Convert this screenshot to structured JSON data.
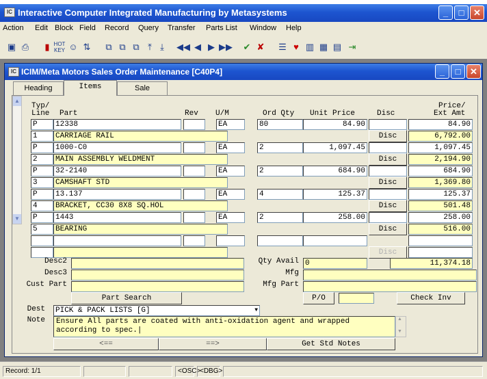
{
  "app": {
    "title": "Interactive Computer Integrated Manufacturing by Metasystems",
    "icon": "app-icon"
  },
  "menu": [
    "Action",
    "Edit",
    "Block",
    "Field",
    "Record",
    "Query",
    "Transfer",
    "Parts List",
    "Window",
    "Help"
  ],
  "toolbar_icons": [
    "save-icon",
    "print-icon",
    "stop-icon",
    "hotkey-icon",
    "user-check-icon",
    "sort-icon",
    "copy-record-icon",
    "paste-record-icon",
    "duplicate-record-icon",
    "insert-record-icon",
    "delete-record-icon",
    "first-record-icon",
    "previous-record-icon",
    "next-record-icon",
    "last-record-icon",
    "check-icon",
    "cancel-icon",
    "list-icon",
    "favorite-icon",
    "chart-icon",
    "table-icon",
    "grid-icon",
    "exit-icon"
  ],
  "child": {
    "title": "ICIM/Meta Motors   Sales Order Maintenance [C40P4]"
  },
  "tabs": [
    {
      "label": "Heading",
      "active": false
    },
    {
      "label": "Items",
      "active": true
    },
    {
      "label": "Sale",
      "active": false
    }
  ],
  "columns": {
    "typ": "Typ/",
    "line": "Line",
    "part": "Part",
    "rev": "Rev",
    "um": "U/M",
    "ord_qty": "Ord Qty",
    "unit_price": "Unit Price",
    "disc": "Disc",
    "price": "Price/",
    "ext_amt": "Ext Amt"
  },
  "items": [
    {
      "typ": "P",
      "part": "12338",
      "rev": "",
      "um": "EA",
      "ord_qty": "80",
      "unit_price": "84.90",
      "price": "84.90",
      "line": "1",
      "desc": "CARRIAGE RAIL",
      "disc_label": "Disc",
      "ext_amt": "6,792.00"
    },
    {
      "typ": "P",
      "part": "1000-C0",
      "rev": "",
      "um": "EA",
      "ord_qty": "2",
      "unit_price": "1,097.45",
      "price": "1,097.45",
      "line": "2",
      "desc": "MAIN ASSEMBLY WELDMENT",
      "disc_label": "Disc",
      "ext_amt": "2,194.90"
    },
    {
      "typ": "P",
      "part": "32-2140",
      "rev": "",
      "um": "EA",
      "ord_qty": "2",
      "unit_price": "684.90",
      "price": "684.90",
      "line": "3",
      "desc": "CAMSHAFT STD",
      "disc_label": "Disc",
      "ext_amt": "1,369.80"
    },
    {
      "typ": "P",
      "part": "13.137",
      "rev": "",
      "um": "EA",
      "ord_qty": "4",
      "unit_price": "125.37",
      "price": "125.37",
      "line": "4",
      "desc": "BRACKET, CC30 8X8 SQ.HOL",
      "disc_label": "Disc",
      "ext_amt": "501.48"
    },
    {
      "typ": "P",
      "part": "1443",
      "rev": "",
      "um": "EA",
      "ord_qty": "2",
      "unit_price": "258.00",
      "price": "258.00",
      "line": "5",
      "desc": "BEARING",
      "disc_label": "Disc",
      "ext_amt": "516.00"
    }
  ],
  "empty_row": {
    "disc_label": "Disc"
  },
  "detail": {
    "desc2_label": "Desc2",
    "desc2_value": "",
    "desc3_label": "Desc3",
    "desc3_value": "",
    "cust_part_label": "Cust Part",
    "cust_part_value": "",
    "qty_avail_label": "Qty Avail",
    "qty_avail_value": "0",
    "mfg_label": "Mfg",
    "mfg_value": "",
    "mfg_part_label": "Mfg Part",
    "mfg_part_value": "",
    "total": "11,374.18"
  },
  "buttons": {
    "part_search": "Part Search",
    "po": "P/O",
    "check_inv": "Check Inv",
    "prev": "<==",
    "next": "==>",
    "get_std_notes": "Get Std Notes"
  },
  "po_value": "",
  "dest": {
    "label": "Dest",
    "value": "PICK & PACK LISTS [G]"
  },
  "note": {
    "label": "Note",
    "value": "Ensure All parts are coated with anti-oxidation agent and wrapped according to spec.|"
  },
  "status": {
    "record": "Record: 1/1",
    "osc": "<OSC>",
    "dbg": "<DBG>"
  },
  "colors": {
    "titlebar": "#1d55d0",
    "field_highlight": "#ffffc0",
    "window_face": "#ece9d8"
  }
}
